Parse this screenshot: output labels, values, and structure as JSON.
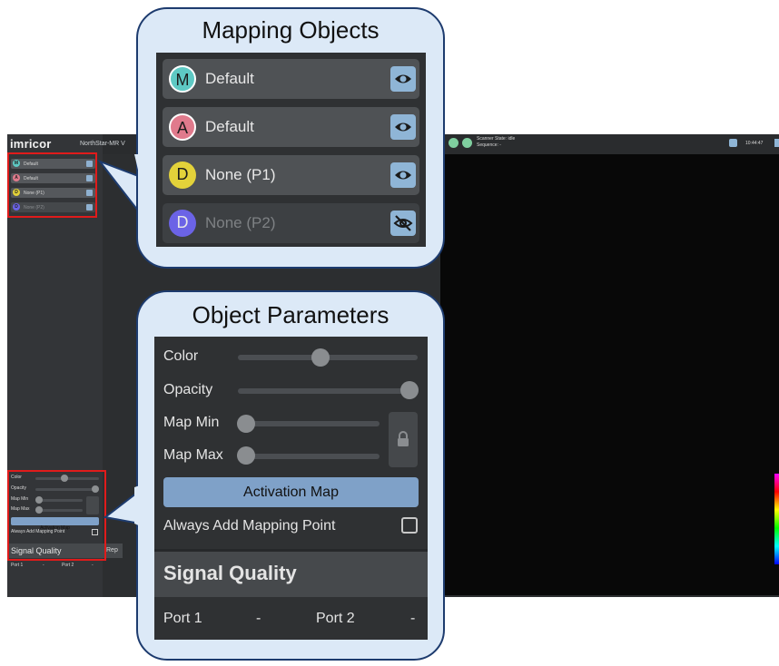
{
  "app": {
    "logo": "imricor",
    "product": "NorthStar-MR V",
    "scanner_state": "Scanner State: idle",
    "sequence": "Sequence: -",
    "clock": "10:44:47",
    "mini_objects": [
      {
        "letter": "M",
        "label": "Default",
        "color": "#5ec9c4"
      },
      {
        "letter": "A",
        "label": "Default",
        "color": "#e07a8c"
      },
      {
        "letter": "D",
        "label": "None (P1)",
        "color": "#e3d23a"
      },
      {
        "letter": "D",
        "label": "None (P2)",
        "color": "#6b63e6"
      }
    ],
    "mini_params": {
      "color": "Color",
      "opacity": "Opacity",
      "map_min": "Map Min",
      "map_max": "Map Max",
      "activation_map": "Activation Map",
      "always_add": "Always Add Mapping Point",
      "signal_quality": "Signal Quality",
      "rep_tab": "Rep",
      "port1": "Port 1",
      "port1_val": "-",
      "port2": "Port 2",
      "port2_val": "-"
    }
  },
  "callout_objects": {
    "title": "Mapping Objects",
    "items": [
      {
        "letter": "M",
        "label": "Default",
        "badge_color": "#5ec9c4",
        "badge_ring": "#b5ece9",
        "visible": true
      },
      {
        "letter": "A",
        "label": "Default",
        "badge_color": "#e07a8c",
        "badge_ring": "#f4c3cc",
        "visible": true
      },
      {
        "letter": "D",
        "label": "None (P1)",
        "badge_color": "#e3d23a",
        "badge_ring": "#e3d23a",
        "visible": true
      },
      {
        "letter": "D",
        "label": "None (P2)",
        "badge_color": "#6b63e6",
        "badge_ring": "#6b63e6",
        "visible": false
      }
    ],
    "icons": {
      "visible": "eye-icon",
      "hidden": "eye-off-icon"
    }
  },
  "callout_params": {
    "title": "Object Parameters",
    "color_label": "Color",
    "color_value": 0.46,
    "opacity_label": "Opacity",
    "opacity_value": 1.0,
    "map_min_label": "Map Min",
    "map_min_value": 0.0,
    "map_max_label": "Map Max",
    "map_max_value": 0.0,
    "lock_icon": "lock-icon",
    "activation_button": "Activation Map",
    "always_add_label": "Always Add Mapping Point",
    "always_add_checked": false,
    "signal_quality": "Signal Quality",
    "port1_label": "Port 1",
    "port1_value": "-",
    "port2_label": "Port 2",
    "port2_value": "-"
  },
  "colors": {
    "highlight_border": "#e01b1b",
    "callout_fill": "#dce9f7",
    "callout_border": "#1d3b6e",
    "eye_button": "#8fb5d6",
    "activation_button": "#7fa1c8"
  }
}
